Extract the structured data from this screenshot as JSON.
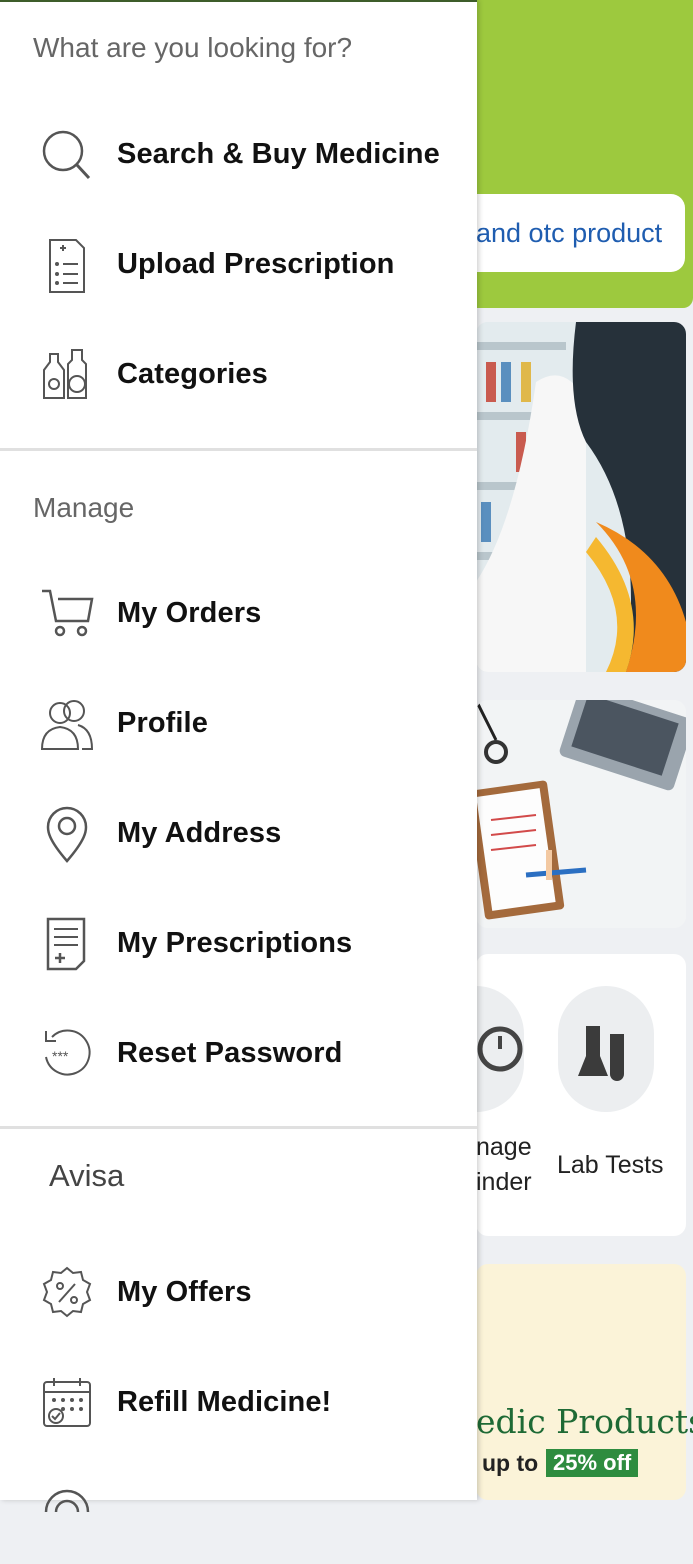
{
  "drawer": {
    "search_section": {
      "title": "What are you looking for?",
      "items": [
        {
          "label": "Search & Buy Medicine",
          "icon": "search-icon"
        },
        {
          "label": "Upload Prescription",
          "icon": "prescription-icon"
        },
        {
          "label": "Categories",
          "icon": "categories-icon"
        }
      ]
    },
    "manage_section": {
      "title": "Manage",
      "items": [
        {
          "label": "My Orders",
          "icon": "cart-icon"
        },
        {
          "label": "Profile",
          "icon": "profile-icon"
        },
        {
          "label": "My Address",
          "icon": "location-pin-icon"
        },
        {
          "label": "My Prescriptions",
          "icon": "document-icon"
        },
        {
          "label": "Reset Password",
          "icon": "reset-password-icon"
        }
      ]
    },
    "brand_section": {
      "title": "Avisa",
      "items": [
        {
          "label": "My Offers",
          "icon": "offer-badge-icon"
        },
        {
          "label": "Refill Medicine!",
          "icon": "calendar-icon"
        }
      ]
    }
  },
  "background": {
    "search_text": "and otc product",
    "card_labels": {
      "left_line1": "nage",
      "left_line2": "inder",
      "right": "Lab Tests"
    },
    "promo": {
      "title": "edic Products",
      "sub": "up to",
      "badge": "25% off"
    }
  },
  "colors": {
    "accent_green": "#9dc93e",
    "link_blue": "#1f5db0",
    "promo_green": "#2e8c3f"
  }
}
